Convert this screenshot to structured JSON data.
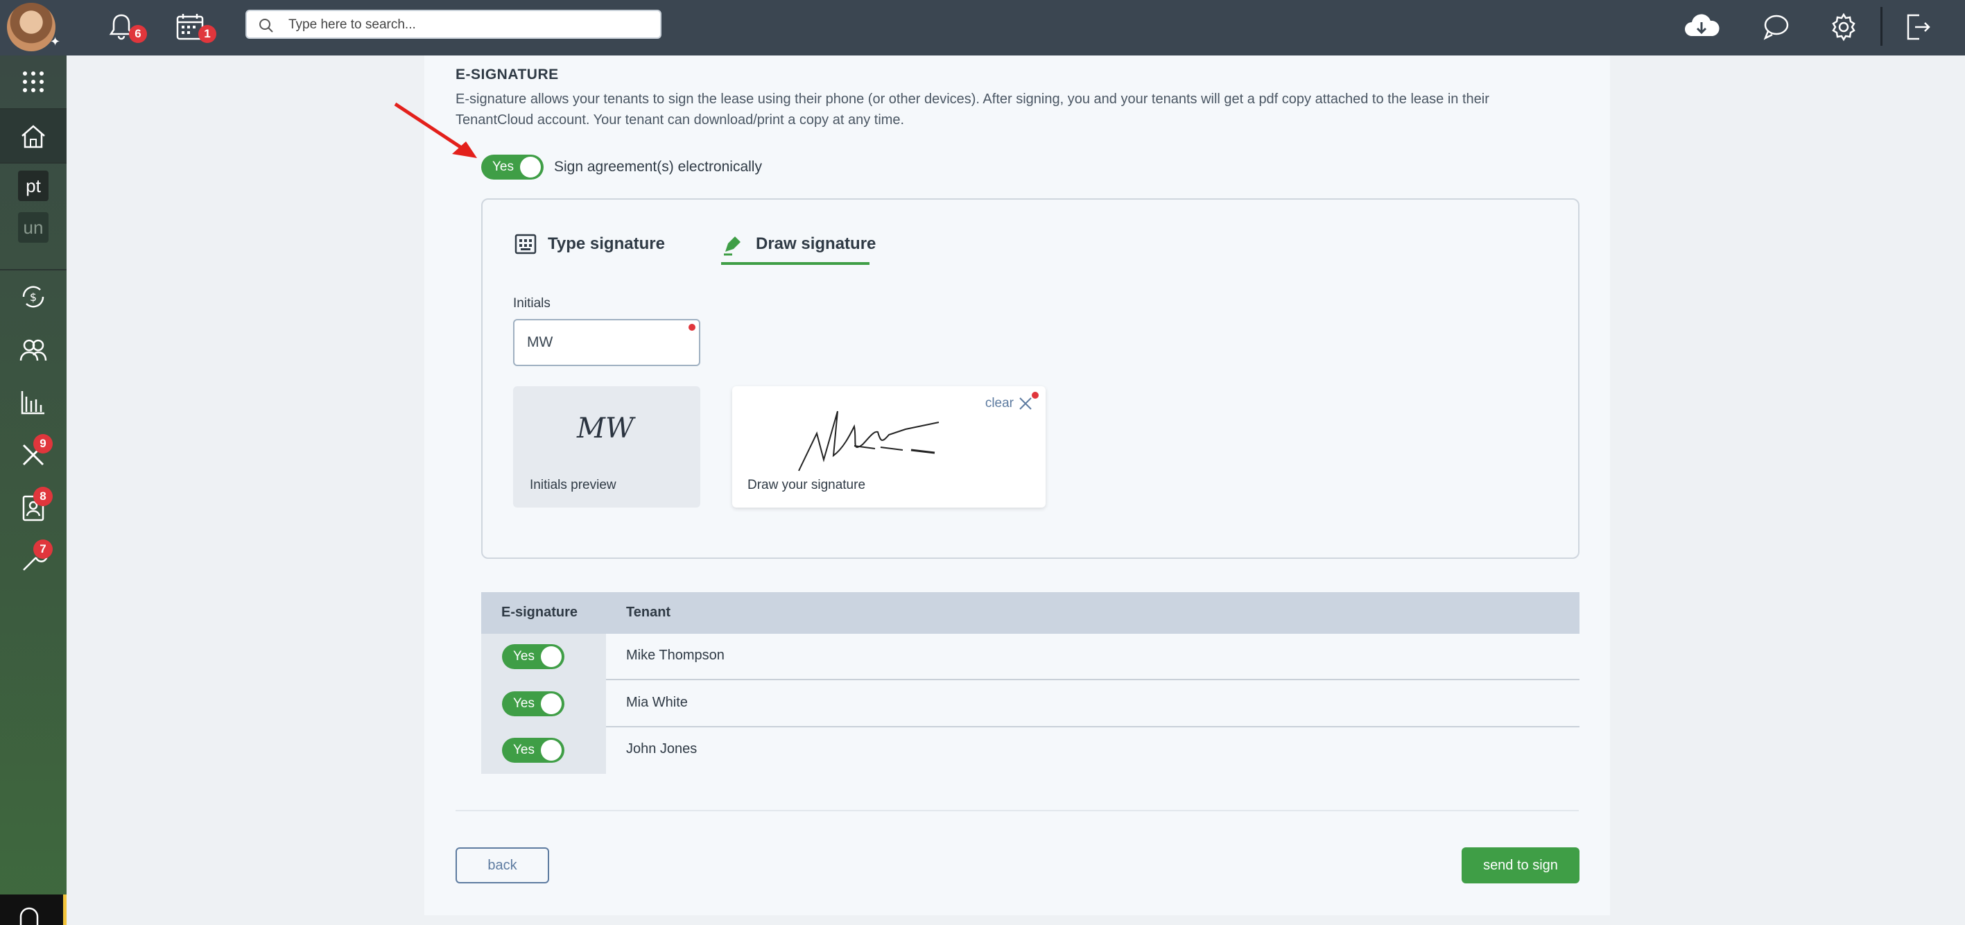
{
  "topbar": {
    "notifications_count": "6",
    "calendar_count": "1",
    "search_placeholder": "Type here to search..."
  },
  "sidebar": {
    "tags": [
      "pt",
      "un"
    ],
    "badges": {
      "maintenance": "9",
      "applications": "8",
      "tools": "7"
    }
  },
  "esign": {
    "title": "E-SIGNATURE",
    "description": "E-signature allows your tenants to sign the lease using their phone (or other devices). After signing, you and your tenants will get a pdf copy attached to the lease in their TenantCloud account. Your tenant can download/print a copy at any time.",
    "toggle_label": "Yes",
    "toggle_text": "Sign agreement(s) electronically"
  },
  "signature": {
    "tabs": [
      "Type signature",
      "Draw signature"
    ],
    "active_tab": "Draw signature",
    "initials_label": "Initials",
    "initials_value": "MW",
    "initials_preview_text": "MW",
    "initials_preview_caption": "Initials preview",
    "draw_caption": "Draw your signature",
    "clear_label": "clear"
  },
  "tenants_table": {
    "headers": [
      "E-signature",
      "Tenant"
    ],
    "rows": [
      {
        "esign": "Yes",
        "tenant": "Mike Thompson"
      },
      {
        "esign": "Yes",
        "tenant": "Mia White"
      },
      {
        "esign": "Yes",
        "tenant": "John Jones"
      }
    ]
  },
  "actions": {
    "back": "back",
    "send": "send to sign"
  },
  "colors": {
    "accent": "#3f9e46",
    "topbar": "#3b4651",
    "badge": "#e0363c",
    "link": "#5d7ba0"
  }
}
